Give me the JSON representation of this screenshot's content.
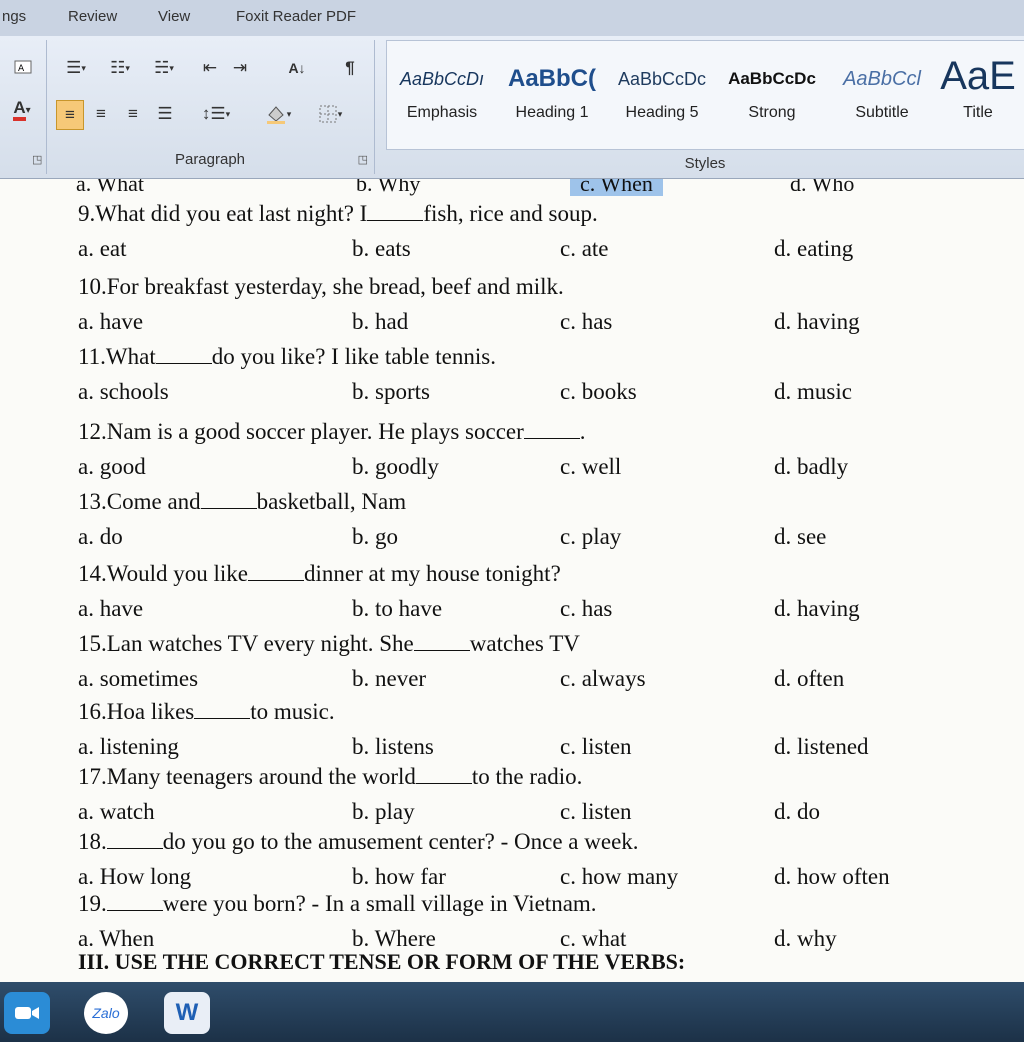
{
  "menu": [
    "ngs",
    "Review",
    "View",
    "Foxit Reader PDF"
  ],
  "paragraph_group": {
    "label": "Paragraph",
    "sort_glyph": "A↓",
    "pilcrow": "¶"
  },
  "styles_group": {
    "label": "Styles",
    "tiles": [
      {
        "sample": "AaBbCcDı",
        "name": "Emphasis"
      },
      {
        "sample": "AaBbC(",
        "name": "Heading 1"
      },
      {
        "sample": "AaBbCcDc",
        "name": "Heading 5"
      },
      {
        "sample": "AaBbCcDc",
        "name": "Strong"
      },
      {
        "sample": "AaBbCcl",
        "name": "Subtitle"
      },
      {
        "sample": "AaE",
        "name": "Title"
      }
    ]
  },
  "colors": {
    "highlight": "#9ec3ea",
    "accent": "#f6c978",
    "font_color_bar": "#d9322b"
  },
  "document": {
    "cut_options": [
      "a. What",
      "b. Why",
      "c. When",
      "d. Who"
    ],
    "questions": [
      {
        "num": "9.",
        "pre": "What did you eat last night? I",
        "post": "fish, rice and soup.",
        "options": [
          "a. eat",
          "b. eats",
          "c. ate",
          "d. eating"
        ]
      },
      {
        "num": "10.",
        "pre": "For breakfast yesterday, she bread, beef and milk.",
        "post": "",
        "options": [
          "a. have",
          "b. had",
          "c. has",
          "d. having"
        ]
      },
      {
        "num": "11.",
        "pre": "What",
        "post": "do you like? I like table tennis.",
        "options": [
          "a. schools",
          "b. sports",
          "c. books",
          "d. music"
        ]
      },
      {
        "num": "12.",
        "pre": "Nam is a good soccer player. He plays soccer",
        "post": ".",
        "options": [
          "a. good",
          "b. goodly",
          "c. well",
          "d. badly"
        ]
      },
      {
        "num": "13.",
        "pre": "Come and",
        "post": "basketball, Nam",
        "options": [
          "a. do",
          "b. go",
          "c. play",
          "d. see"
        ]
      },
      {
        "num": "14.",
        "pre": "Would you like",
        "post": "dinner at my house tonight?",
        "options": [
          "a. have",
          "b. to have",
          "c. has",
          "d. having"
        ]
      },
      {
        "num": "15.",
        "pre": "Lan watches TV every night. She",
        "post": "watches TV",
        "options": [
          "a. sometimes",
          "b. never",
          "c. always",
          "d. often"
        ]
      },
      {
        "num": "16.",
        "pre": "Hoa likes",
        "post": "to music.",
        "options": [
          "a. listening",
          "b. listens",
          "c. listen",
          "d. listened"
        ]
      },
      {
        "num": "17.",
        "pre": "Many teenagers around the world",
        "post": "to the radio.",
        "options": [
          "a. watch",
          "b. play",
          "c. listen",
          "d. do"
        ]
      },
      {
        "num": "18.",
        "pre": "",
        "post": "do you go to the amusement center? - Once a week.",
        "options": [
          "a. How long",
          "b. how far",
          "c. how many",
          "d. how often"
        ]
      },
      {
        "num": "19.",
        "pre": "",
        "post": "were you born? - In a small village in Vietnam.",
        "options": [
          "a. When",
          "b. Where",
          "c. what",
          "d. why"
        ]
      }
    ],
    "section_heading": "III. USE THE CORRECT TENSE OR FORM OF THE VERBS:"
  },
  "taskbar": {
    "apps": [
      "Zalo",
      "W"
    ]
  }
}
